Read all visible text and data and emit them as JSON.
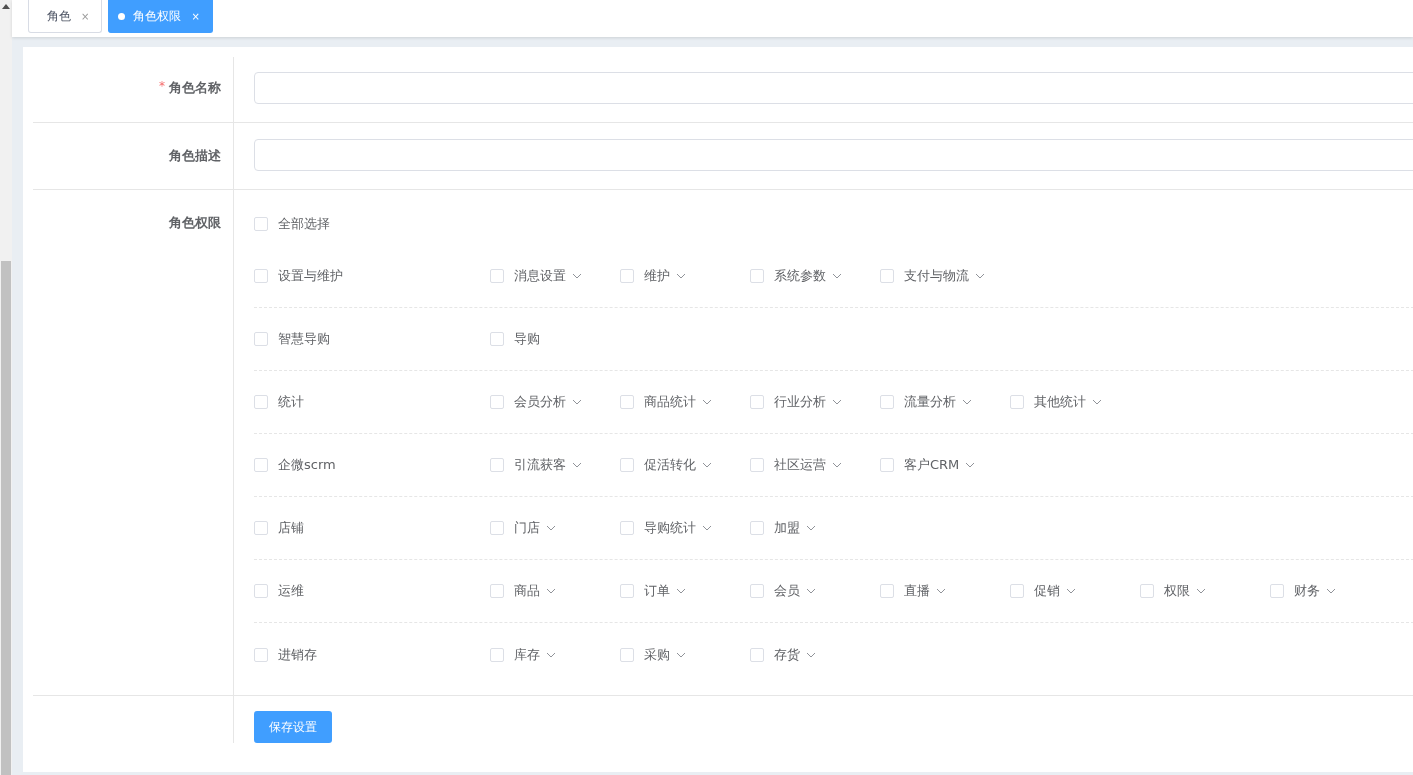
{
  "tabs": [
    {
      "label": "角色",
      "close": "×",
      "selected": false
    },
    {
      "label": "角色权限",
      "close": "×",
      "selected": true
    }
  ],
  "form": {
    "name_field": {
      "label": "角色名称",
      "required_mark": "*"
    },
    "description_field": {
      "label": "角色描述"
    },
    "permissions": {
      "label": "角色权限",
      "select_all": {
        "label": "全部选择",
        "checked": false
      },
      "groups": [
        {
          "label": "设置与维护",
          "checked": false,
          "children": [
            {
              "label": "消息设置",
              "checked": false,
              "expandable": true
            },
            {
              "label": "维护",
              "checked": false,
              "expandable": true
            },
            {
              "label": "系统参数",
              "checked": false,
              "expandable": true
            },
            {
              "label": "支付与物流",
              "checked": false,
              "expandable": true
            }
          ]
        },
        {
          "label": "智慧导购",
          "checked": false,
          "children": [
            {
              "label": "导购",
              "checked": false,
              "expandable": false
            }
          ]
        },
        {
          "label": "统计",
          "checked": false,
          "children": [
            {
              "label": "会员分析",
              "checked": false,
              "expandable": true
            },
            {
              "label": "商品统计",
              "checked": false,
              "expandable": true
            },
            {
              "label": "行业分析",
              "checked": false,
              "expandable": true
            },
            {
              "label": "流量分析",
              "checked": false,
              "expandable": true
            },
            {
              "label": "其他统计",
              "checked": false,
              "expandable": true
            }
          ]
        },
        {
          "label": "企微scrm",
          "checked": false,
          "children": [
            {
              "label": "引流获客",
              "checked": false,
              "expandable": true
            },
            {
              "label": "促活转化",
              "checked": false,
              "expandable": true
            },
            {
              "label": "社区运营",
              "checked": false,
              "expandable": true
            },
            {
              "label": "客户CRM",
              "checked": false,
              "expandable": true
            }
          ]
        },
        {
          "label": "店铺",
          "checked": false,
          "children": [
            {
              "label": "门店",
              "checked": false,
              "expandable": true
            },
            {
              "label": "导购统计",
              "checked": false,
              "expandable": true
            },
            {
              "label": "加盟",
              "checked": false,
              "expandable": true
            }
          ]
        },
        {
          "label": "运维",
          "checked": false,
          "children": [
            {
              "label": "商品",
              "checked": false,
              "expandable": true
            },
            {
              "label": "订单",
              "checked": false,
              "expandable": true
            },
            {
              "label": "会员",
              "checked": false,
              "expandable": true
            },
            {
              "label": "直播",
              "checked": false,
              "expandable": true
            },
            {
              "label": "促销",
              "checked": false,
              "expandable": true
            },
            {
              "label": "权限",
              "checked": false,
              "expandable": true
            },
            {
              "label": "财务",
              "checked": false,
              "expandable": true
            }
          ]
        },
        {
          "label": "进销存",
          "checked": false,
          "children": [
            {
              "label": "库存",
              "checked": false,
              "expandable": true
            },
            {
              "label": "采购",
              "checked": false,
              "expandable": true
            },
            {
              "label": "存货",
              "checked": false,
              "expandable": true
            }
          ]
        }
      ]
    },
    "save_button": "保存设置"
  }
}
